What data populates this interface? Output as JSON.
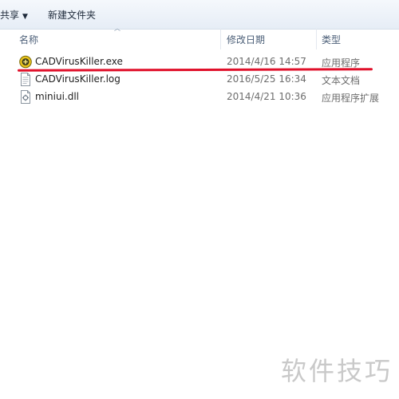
{
  "toolbar": {
    "share_label": "共享",
    "new_folder_label": "新建文件夹"
  },
  "columns": {
    "name": "名称",
    "date": "修改日期",
    "type": "类型"
  },
  "files": [
    {
      "name": "CADVirusKiller.exe",
      "date": "2014/4/16 14:57",
      "type": "应用程序",
      "icon": "exe-app-icon"
    },
    {
      "name": "CADVirusKiller.log",
      "date": "2016/5/25 16:34",
      "type": "文本文档",
      "icon": "text-file-icon"
    },
    {
      "name": "miniui.dll",
      "date": "2014/4/21 10:36",
      "type": "应用程序扩展",
      "icon": "dll-file-icon"
    }
  ],
  "highlight_color": "#e0102a",
  "watermark": "软件技巧"
}
